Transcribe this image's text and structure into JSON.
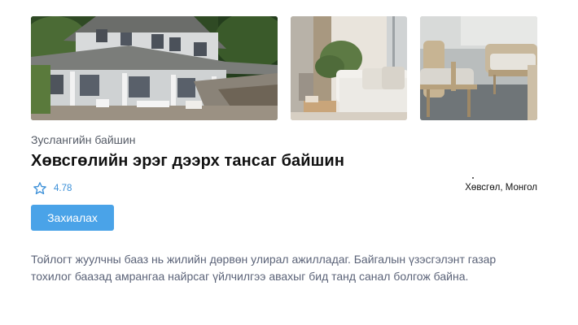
{
  "listing": {
    "category": "Зуслангийн байшин",
    "title": "Хөвсгөлийн эрэг дээрх тансаг байшин",
    "rating": "4.78",
    "location": "Хөвсгөл, Монгол",
    "book_label": "Захиалах",
    "description_line1": "Тойлогт жуулчны бааз нь жилийн дөрвөн улирал ажилладаг. Байгалын үзэсгэлэнт газар",
    "description_line2": "тохилог баазад амрангаа найрсаг үйлчилгээ авахыг бид танд санал болгож байна."
  },
  "gallery": {
    "photos": [
      "house-exterior-photo",
      "living-room-photo",
      "patio-chairs-photo"
    ]
  },
  "colors": {
    "accent": "#4aa3e8",
    "rating_text": "#3a8fd8",
    "description_text": "#5b6378"
  },
  "icons": {
    "rating": "star-outline-icon"
  }
}
